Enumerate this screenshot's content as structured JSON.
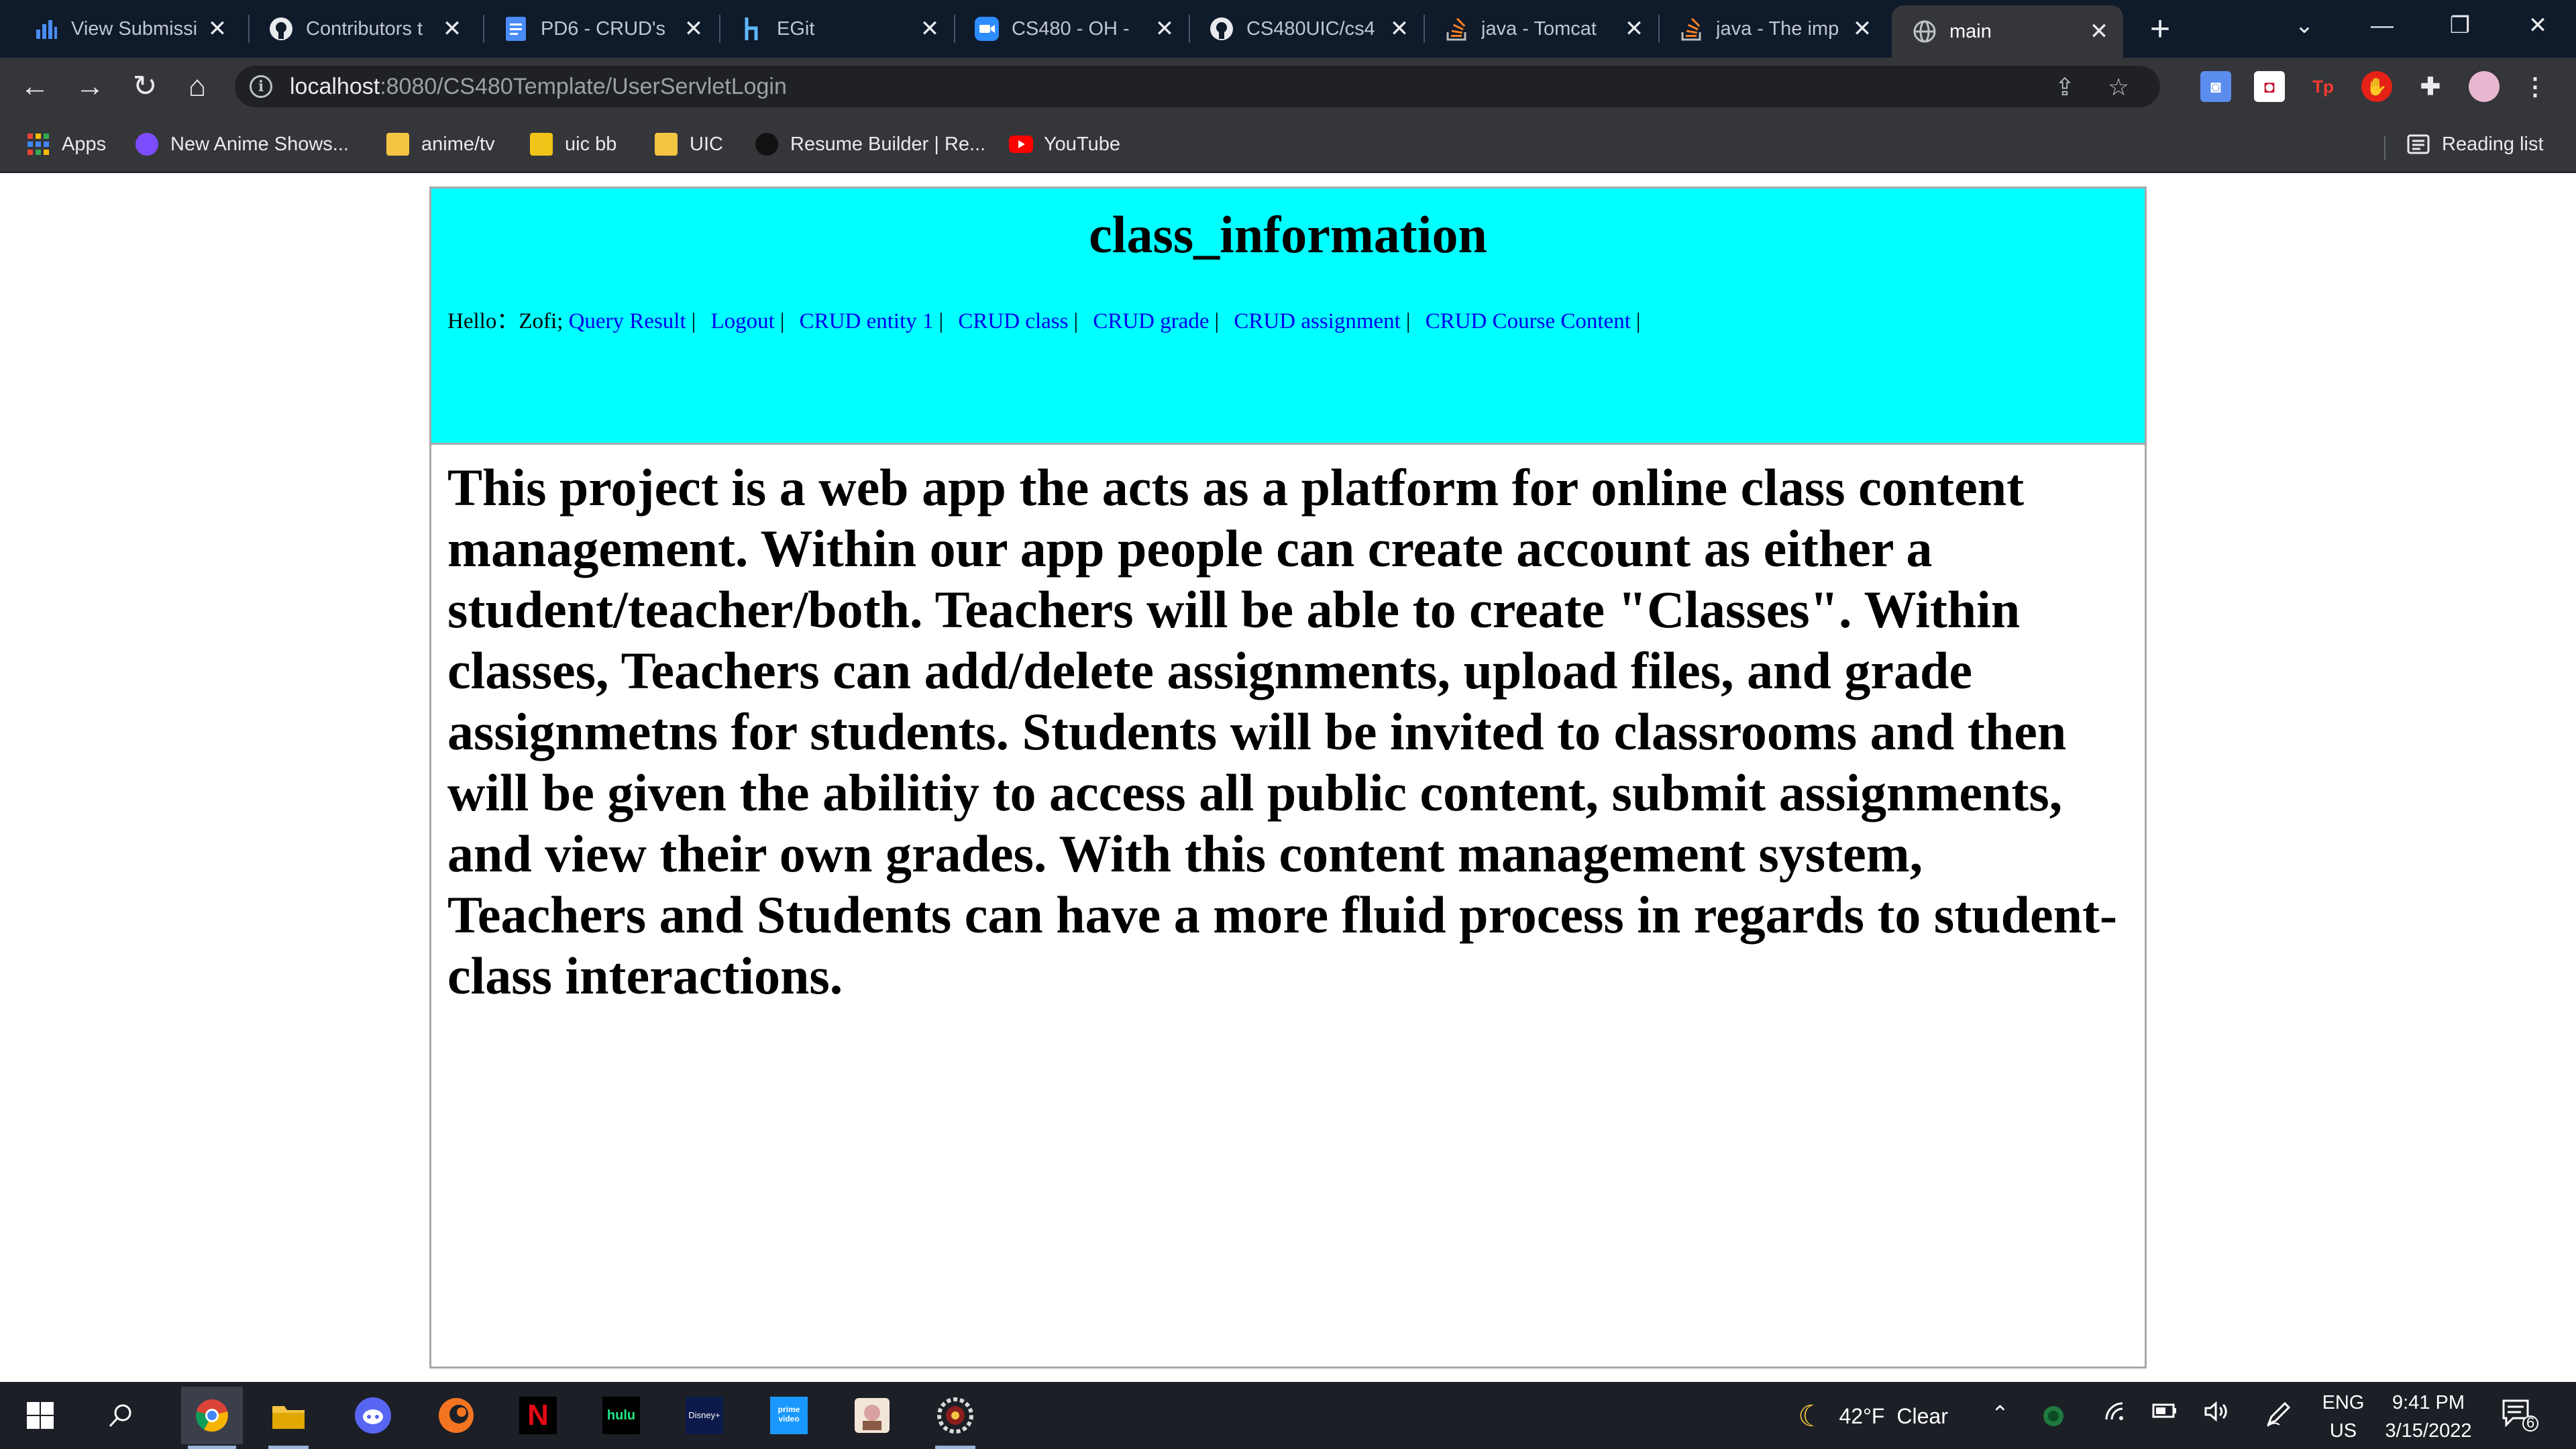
{
  "browser": {
    "tabs": [
      {
        "title": "View Submissi",
        "icon": "bar-chart-icon"
      },
      {
        "title": "Contributors t",
        "icon": "github-icon"
      },
      {
        "title": "PD6 - CRUD's",
        "icon": "docs-icon"
      },
      {
        "title": "EGit",
        "icon": "egit-icon"
      },
      {
        "title": "CS480 - OH -",
        "icon": "zoom-icon"
      },
      {
        "title": "CS480UIC/cs4",
        "icon": "github-icon"
      },
      {
        "title": "java - Tomcat",
        "icon": "stackoverflow-icon"
      },
      {
        "title": "java - The imp",
        "icon": "stackoverflow-icon"
      },
      {
        "title": "main",
        "icon": "globe-icon",
        "active": true
      }
    ],
    "tab_close_glyph": "✕",
    "new_tab_glyph": "+",
    "address": {
      "host": "localhost",
      "path": ":8080/CS480Template/UserServletLogin"
    },
    "bookmarks": [
      {
        "label": "Apps",
        "icon": "apps-grid-icon"
      },
      {
        "label": "New Anime Shows...",
        "icon": "anime-icon"
      },
      {
        "label": "anime/tv",
        "icon": "folder-icon"
      },
      {
        "label": "uic bb",
        "icon": "pencil-icon"
      },
      {
        "label": "UIC",
        "icon": "folder-icon"
      },
      {
        "label": "Resume Builder | Re...",
        "icon": "resume-icon"
      },
      {
        "label": "YouTube",
        "icon": "youtube-icon"
      }
    ],
    "reading_list": "Reading list"
  },
  "page": {
    "title": "class_information",
    "greeting": "Hello：Zofi;",
    "nav_links": [
      "Query Result",
      "Logout",
      "CRUD entity 1",
      "CRUD class",
      "CRUD grade",
      "CRUD assignment",
      "CRUD Course Content"
    ],
    "nav_separator": "|",
    "description": "This project is a web app the acts as a platform for online class content management. Within our app people can create account as either a student/teacher/both. Teachers will be able to create \"Classes\". Within classes, Teachers can add/delete assignments, upload files, and grade assignmetns for students. Students will be invited to classrooms and then will be given the abilitiy to access all public content, submit assignments, and view their own grades. With this content management system, Teachers and Students can have a more fluid process in regards to student-class interactions."
  },
  "taskbar": {
    "weather": {
      "temp": "42°F",
      "condition": "Clear"
    },
    "language": {
      "lang": "ENG",
      "region": "US"
    },
    "clock": {
      "time": "9:41 PM",
      "date": "3/15/2022"
    },
    "notification_count": "6",
    "app_labels": {
      "netflix": "N",
      "hulu": "hulu",
      "disney": "Disney+",
      "prime": "prime video"
    }
  },
  "colors": {
    "banner": "#00ffff",
    "link": "#0000ee",
    "chrome_dark": "#202124",
    "toolbar": "#35363a"
  }
}
